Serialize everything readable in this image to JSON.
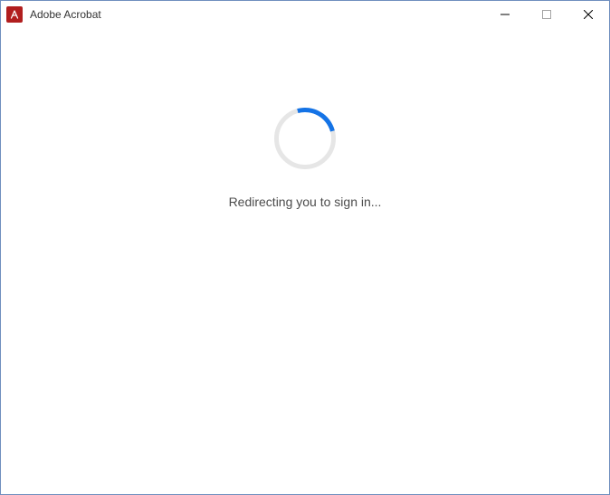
{
  "window": {
    "title": "Adobe Acrobat"
  },
  "content": {
    "status_text": "Redirecting you to sign in..."
  },
  "icons": {
    "app": "acrobat-icon",
    "minimize": "minimize-icon",
    "maximize": "maximize-icon",
    "close": "close-icon"
  }
}
